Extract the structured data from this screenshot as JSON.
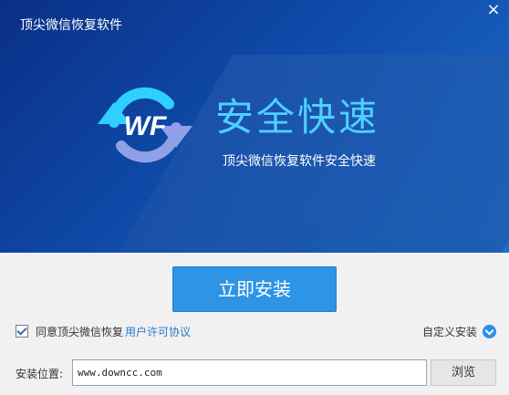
{
  "window": {
    "title": "顶尖微信恢复软件",
    "close_symbol": "×"
  },
  "banner": {
    "logo_text": "WF",
    "slogan": "安全快速",
    "subslogan": "顶尖微信恢复软件安全快速"
  },
  "install_button": {
    "label": "立即安装"
  },
  "agreement": {
    "checked": true,
    "text": "同意顶尖微信恢复",
    "link_label": "用户许可协议"
  },
  "custom_install": {
    "label": "自定义安装"
  },
  "install_path": {
    "label": "安装位置:",
    "value": "www.downcc.com"
  },
  "browse_button": {
    "label": "浏览"
  },
  "colors": {
    "banner_dark": "#0a2f86",
    "banner_light": "#1e6ccc",
    "accent": "#2d94e6",
    "slogan": "#4fd0ff",
    "link": "#2b79c9"
  },
  "icons": [
    "wf-sync-logo-icon",
    "close-icon",
    "checkmark-icon",
    "chevron-down-icon"
  ]
}
